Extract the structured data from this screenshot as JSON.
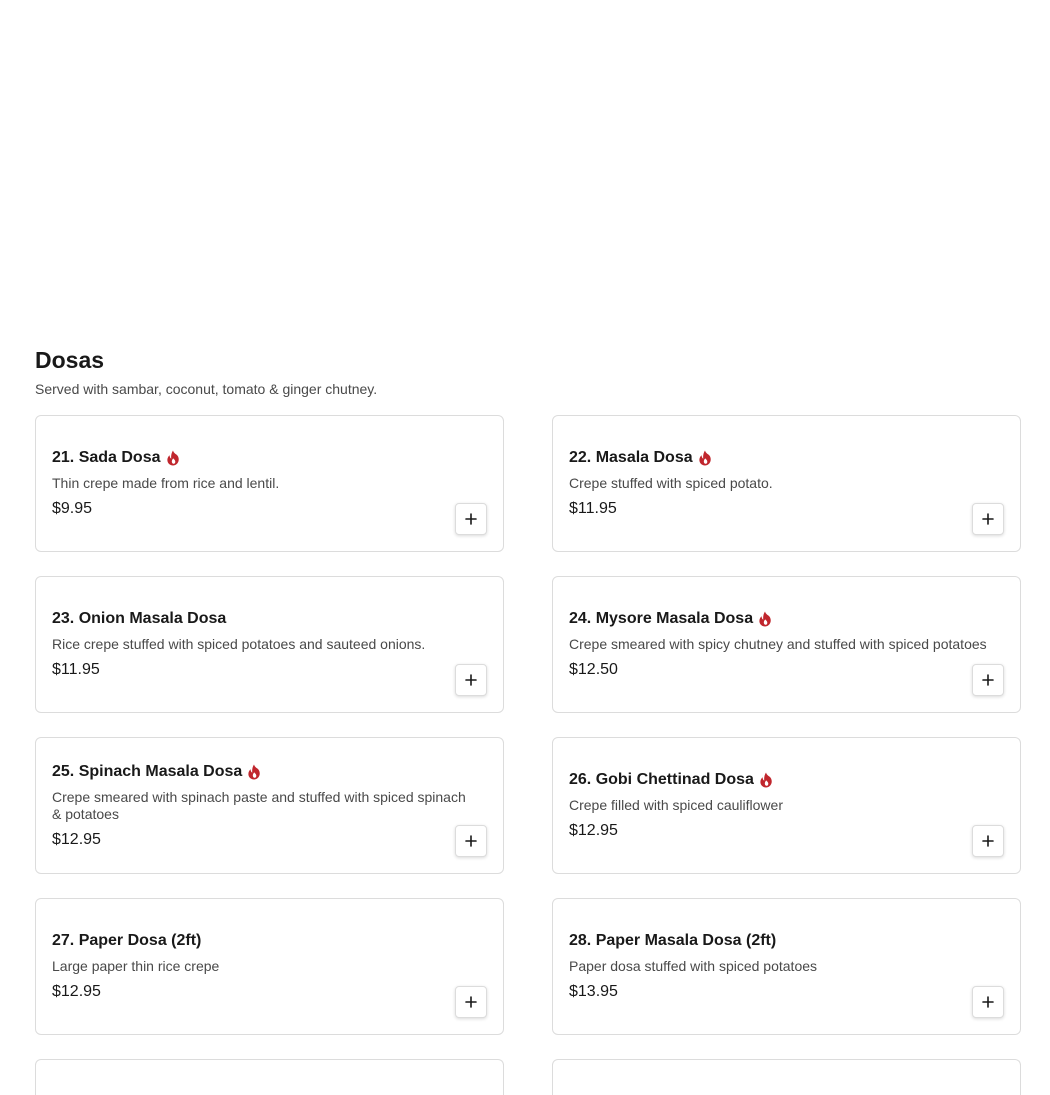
{
  "section": {
    "title": "Dosas",
    "subtitle": "Served with sambar, coconut, tomato & ginger chutney."
  },
  "colors": {
    "spicy_icon": "#c0262d",
    "text_primary": "#191919",
    "text_secondary": "#494949",
    "card_border": "#dcdcdc"
  },
  "items": [
    {
      "name": "21. Sada Dosa",
      "spicy": false,
      "description": "Thin crepe made from rice and lentil.",
      "price": "$9.95"
    },
    {
      "name": "22. Masala Dosa",
      "spicy": true,
      "description": "Crepe stuffed with spiced potato.",
      "price": "$11.95"
    },
    {
      "name": "23. Onion Masala Dosa",
      "spicy": false,
      "description": "Rice crepe stuffed with spiced potatoes and sauteed onions.",
      "price": "$11.95"
    },
    {
      "name": "24. Mysore Masala Dosa",
      "spicy": true,
      "description": "Crepe smeared with spicy chutney and stuffed with spiced potatoes",
      "price": "$12.50"
    },
    {
      "name": "25. Spinach Masala Dosa",
      "spicy": true,
      "description": "Crepe smeared with spinach paste and stuffed with spiced spinach & potatoes",
      "price": "$12.95"
    },
    {
      "name": "26. Gobi Chettinad Dosa",
      "spicy": true,
      "description": "Crepe filled with spiced cauliflower",
      "price": "$12.95"
    },
    {
      "name": "27. Paper Dosa (2ft)",
      "spicy": false,
      "description": "Large paper thin rice crepe",
      "price": "$12.95"
    },
    {
      "name": "28. Paper Masala Dosa (2ft)",
      "spicy": false,
      "description": "Paper dosa stuffed with spiced potatoes",
      "price": "$13.95"
    }
  ],
  "icons": {
    "spicy": "flame-icon",
    "add": "plus-icon"
  }
}
